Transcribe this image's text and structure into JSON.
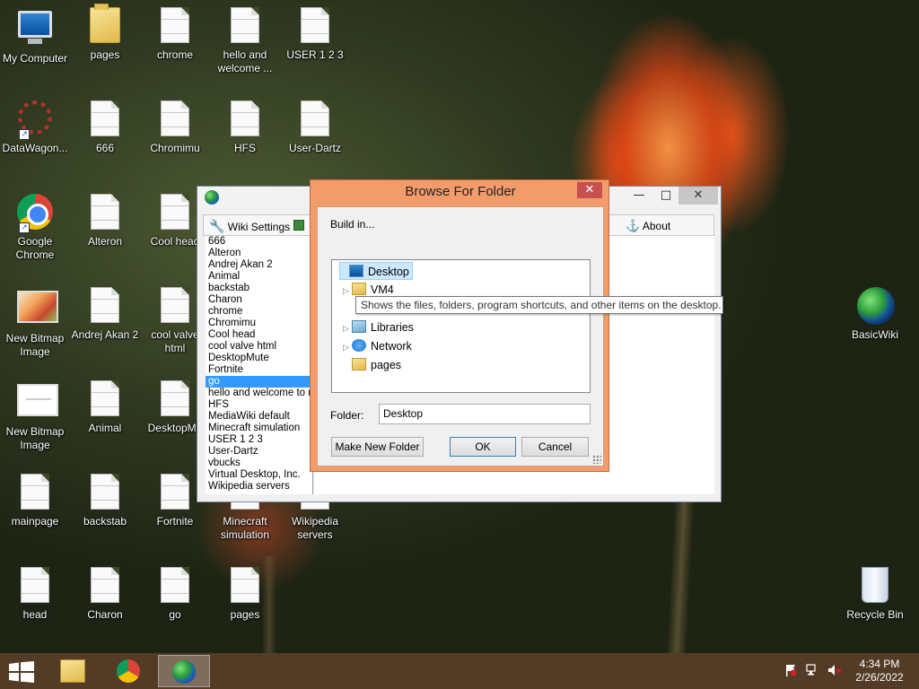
{
  "desktop_icons": [
    {
      "label": "My Computer",
      "icon": "computer-icon"
    },
    {
      "label": "pages",
      "icon": "folder-icon"
    },
    {
      "label": "chrome",
      "icon": "document-icon"
    },
    {
      "label": "hello and welcome ...",
      "icon": "document-icon"
    },
    {
      "label": "USER 1 2 3",
      "icon": "document-icon"
    },
    {
      "label": "DataWagon...",
      "icon": "datawagon-icon"
    },
    {
      "label": "666",
      "icon": "document-icon"
    },
    {
      "label": "Chromimu",
      "icon": "document-icon"
    },
    {
      "label": "HFS",
      "icon": "document-icon"
    },
    {
      "label": "User-Dartz",
      "icon": "document-icon"
    },
    {
      "label": "Google Chrome",
      "icon": "chrome-icon"
    },
    {
      "label": "Alteron",
      "icon": "document-icon"
    },
    {
      "label": "Cool head",
      "icon": "document-icon"
    },
    {
      "label": "New Bitmap Image",
      "icon": "bitmap-icon"
    },
    {
      "label": "Andrej Akan 2",
      "icon": "document-icon"
    },
    {
      "label": "cool valve html",
      "icon": "document-icon"
    },
    {
      "label": "New Bitmap Image",
      "icon": "bitmap-icon"
    },
    {
      "label": "Animal",
      "icon": "document-icon"
    },
    {
      "label": "DesktopMu",
      "icon": "document-icon"
    },
    {
      "label": "mainpage",
      "icon": "document-icon"
    },
    {
      "label": "backstab",
      "icon": "document-icon"
    },
    {
      "label": "Fortnite",
      "icon": "document-icon"
    },
    {
      "label": "Minecraft simulation",
      "icon": "document-icon"
    },
    {
      "label": "Wikipedia servers",
      "icon": "document-icon"
    },
    {
      "label": "head",
      "icon": "document-icon"
    },
    {
      "label": "Charon",
      "icon": "document-icon"
    },
    {
      "label": "go",
      "icon": "document-icon"
    },
    {
      "label": "pages",
      "icon": "document-icon"
    },
    {
      "label": "BasicWiki",
      "icon": "globe-icon"
    },
    {
      "label": "Recycle Bin",
      "icon": "recycle-bin-icon"
    }
  ],
  "app_window": {
    "toolbar": {
      "wiki_settings": "Wiki Settings",
      "about": "About"
    },
    "page_list": [
      "666",
      "Alteron",
      "Andrej Akan 2",
      "Animal",
      "backstab",
      "Charon",
      "chrome",
      "Chromimu",
      "Cool head",
      "cool valve html",
      "DesktopMute",
      "Fortnite",
      "go",
      "hello and welcome to my",
      "HFS",
      "MediaWiki default",
      "Minecraft simulation",
      "USER 1 2 3",
      "User-Dartz",
      "vbucks",
      "Virtual Desktop, Inc.",
      "Wikipedia servers"
    ],
    "selected_page": "go"
  },
  "browse_dialog": {
    "title": "Browse For Folder",
    "prompt": "Build in...",
    "tree": [
      {
        "label": "Desktop",
        "icon": "desktop-icon",
        "selected": true
      },
      {
        "label": "VM4",
        "icon": "user-folder-icon"
      },
      {
        "label": "Libraries",
        "icon": "libraries-icon"
      },
      {
        "label": "Network",
        "icon": "network-icon"
      },
      {
        "label": "pages",
        "icon": "folder-icon"
      }
    ],
    "tooltip": "Shows the files, folders, program shortcuts, and other items on the desktop.",
    "folder_label": "Folder:",
    "folder_value": "Desktop",
    "buttons": {
      "new_folder": "Make New Folder",
      "ok": "OK",
      "cancel": "Cancel"
    }
  },
  "taskbar": {
    "apps": [
      "file-explorer-icon",
      "chrome-icon",
      "basicwiki-icon"
    ],
    "active_app": "basicwiki-icon",
    "tray_icons": [
      "action-center-flag-icon",
      "network-icon",
      "speaker-muted-icon"
    ],
    "time": "4:34 PM",
    "date": "2/26/2022"
  }
}
